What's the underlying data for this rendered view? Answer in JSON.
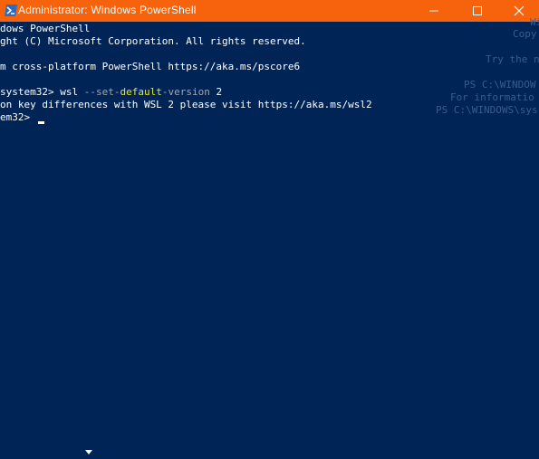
{
  "window": {
    "title": "Administrator: Windows PowerShell",
    "accent_color": "#f7630c",
    "console_bg": "#012456",
    "icons": {
      "app": "powershell-icon",
      "minimize": "minimize-icon",
      "maximize": "maximize-icon",
      "close": "close-icon"
    }
  },
  "console": {
    "lines": [
      "dows PowerShell",
      "ght (C) Microsoft Corporation. All rights reserved.",
      "",
      "m cross-platform PowerShell https://aka.ms/pscore6",
      "",
      ""
    ],
    "command": {
      "prompt": "system32>",
      "cmd": " wsl ",
      "flag": "--set-",
      "flag_hl": "default",
      "flag_rest": "-version ",
      "arg": "2"
    },
    "output_line": "on key differences with WSL 2 please visit https://aka.ms/wsl2",
    "last_prompt": "em32>",
    "ghost_right": {
      "l1": "Wi",
      "l2": "Copy",
      "l3": "Try the n",
      "l4": "PS C:\\WINDOW",
      "l5": "For informatio",
      "l6": "PS C:\\WINDOWS\\sys"
    }
  }
}
